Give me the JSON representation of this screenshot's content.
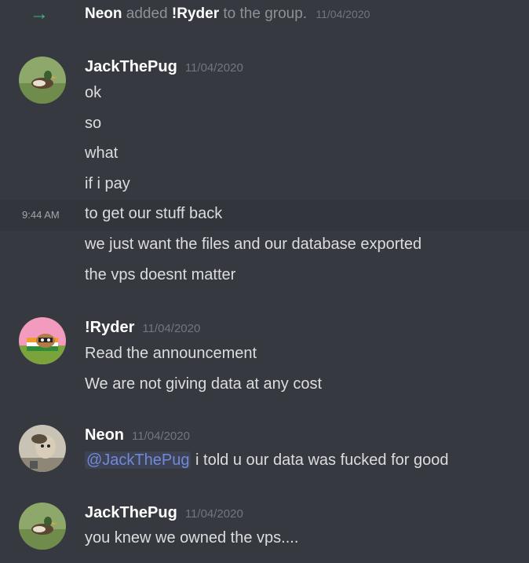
{
  "system_message": {
    "actor": "Neon",
    "action": "added",
    "target": "!Ryder",
    "suffix": "to the group.",
    "timestamp": "11/04/2020",
    "icon": "arrow-right-icon"
  },
  "messages": [
    {
      "author": "JackThePug",
      "timestamp": "11/04/2020",
      "lines": [
        "ok",
        "so",
        "what",
        "if i pay",
        "to get our stuff back",
        "we just want the files and our database exported",
        "the vps doesnt matter"
      ],
      "hover_time": "9:44 AM"
    },
    {
      "author": "!Ryder",
      "timestamp": "11/04/2020",
      "lines": [
        "Read the announcement",
        "We are not giving data at any cost"
      ]
    },
    {
      "author": "Neon",
      "timestamp": "11/04/2020",
      "mention": "@JackThePug",
      "lines": [
        "i told u our data was fucked for good"
      ]
    },
    {
      "author": "JackThePug",
      "timestamp": "11/04/2020",
      "lines": [
        "you knew we owned the vps...."
      ]
    }
  ],
  "colors": {
    "background": "#36393f",
    "hover_row": "#32353b",
    "join_arrow": "#43b581",
    "mention": "#7289da",
    "timestamp": "#72767d"
  }
}
